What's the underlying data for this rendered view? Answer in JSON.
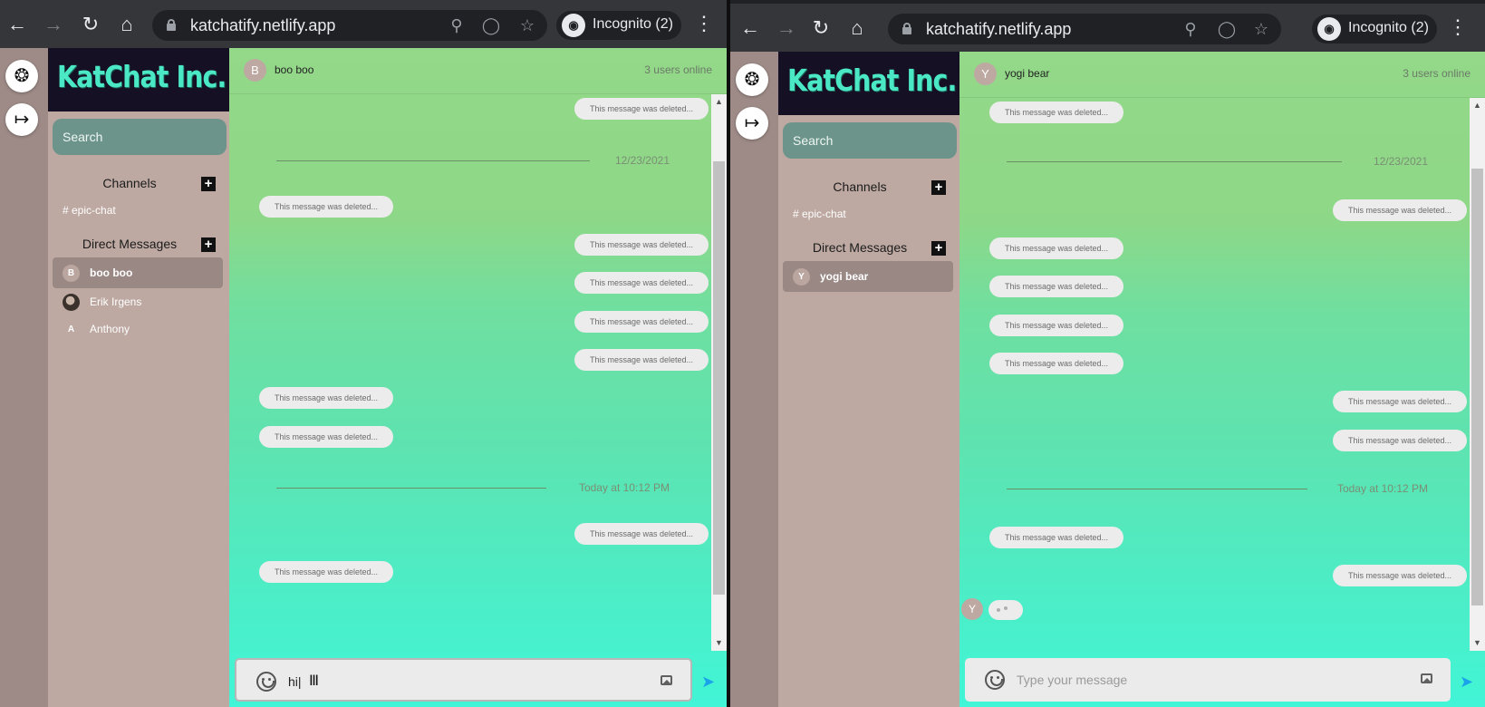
{
  "browser": {
    "url": "katchatify.netlify.app",
    "incognito_label": "Incognito (2)",
    "icons": {
      "back": "arrow-left-icon",
      "forward": "arrow-right-icon",
      "reload": "reload-icon",
      "home": "home-icon",
      "zoom": "zoom-out-icon",
      "eye": "eye-off-icon",
      "star": "star-icon",
      "menu": "kebab-menu-icon"
    }
  },
  "app": {
    "logo": "KatChat Inc.",
    "search_placeholder": "Search",
    "channels_title": "Channels",
    "channel_name": "# epic-chat",
    "dm_title": "Direct Messages",
    "online": "3 users online",
    "deleted": "This message was deleted...",
    "date1": "12/23/2021",
    "date2": "Today at 10:12 PM",
    "type_placeholder": "Type your message",
    "accent": "#1aa3e8"
  },
  "left": {
    "header_initial": "B",
    "header_name": "boo boo",
    "dms": [
      {
        "initial": "B",
        "name": "boo boo"
      },
      {
        "initial": "",
        "name": "Erik Irgens"
      },
      {
        "initial": "A",
        "name": "Anthony"
      }
    ],
    "composer_value": "hi|",
    "messages": [
      "right",
      "left",
      "right",
      "right",
      "right",
      "right",
      "left",
      "left",
      "right",
      "left"
    ]
  },
  "right": {
    "header_initial": "Y",
    "header_name": "yogi bear",
    "dms": [
      {
        "initial": "Y",
        "name": "yogi bear"
      }
    ],
    "typing_initial": "Y",
    "messages": [
      "left",
      "right",
      "left",
      "left",
      "left",
      "left",
      "right",
      "right",
      "left",
      "right"
    ]
  }
}
